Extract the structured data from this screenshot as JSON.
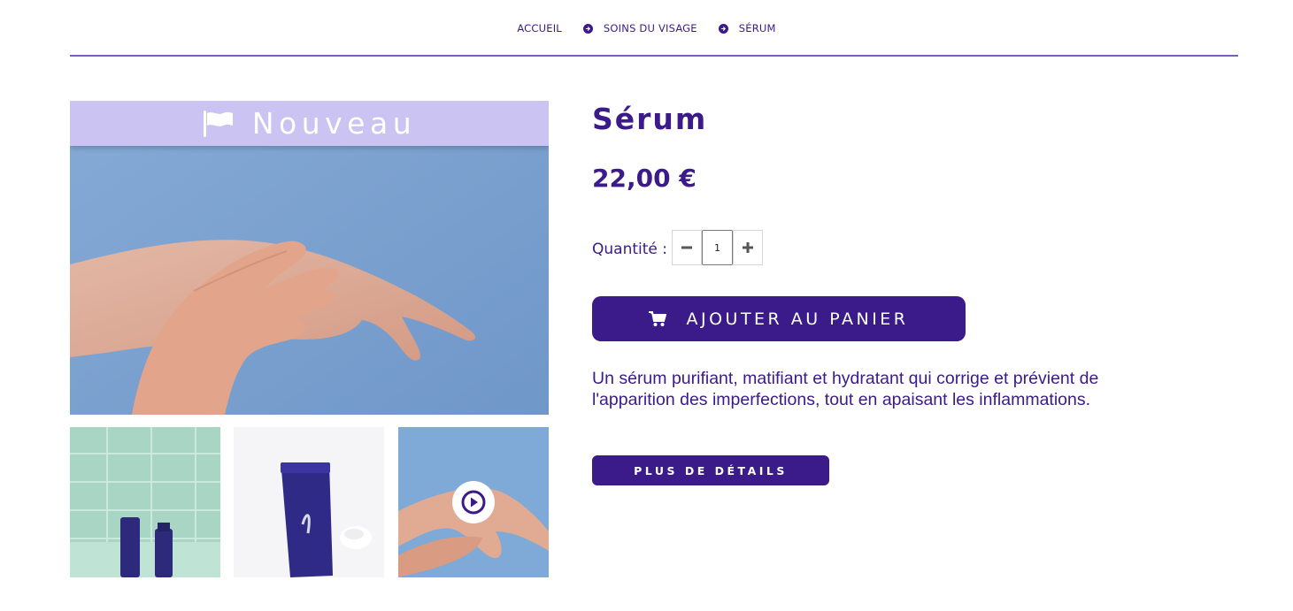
{
  "breadcrumb": {
    "items": [
      "ACCUEIL",
      "SOINS DU VISAGE",
      "SÉRUM"
    ]
  },
  "gallery": {
    "badge": "Nouveau",
    "main_image": "hands-applying-serum-image",
    "thumbnails": [
      "curology-bottles-on-green-tile",
      "curology-tube-and-cream",
      "hands-video"
    ]
  },
  "product": {
    "title": "Sérum",
    "price": "22,00 €",
    "quantity_label": "Quantité :",
    "quantity_value": "1",
    "add_to_cart": "AJOUTER AU PANIER",
    "description": "Un sérum purifiant, matifiant et hydratant qui corrige et prévient de l'apparition des imperfections, tout en apaisant les inflammations.",
    "details_button": "PLUS DE DÉTAILS"
  },
  "colors": {
    "brand": "#3b1a8a",
    "badge_bg": "#cbc3f2",
    "rule": "#7d5bbf"
  },
  "icons": {
    "separator": "arrow-right-circle-icon",
    "badge": "flag-icon",
    "cart": "shopping-cart-icon",
    "video": "play-circle-icon",
    "minus": "minus-icon",
    "plus": "plus-icon"
  }
}
